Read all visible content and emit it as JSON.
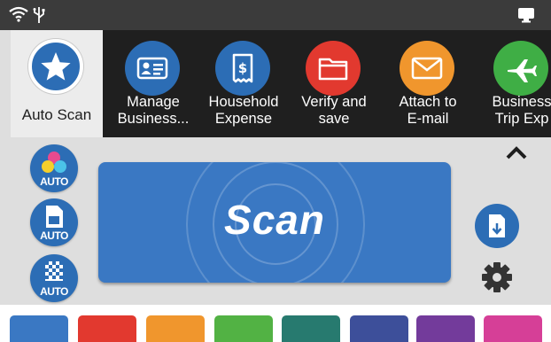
{
  "status_bar": {
    "wifi_icon": "wifi-icon",
    "usb_icon": "usb-icon",
    "screen_icon": "screen-icon"
  },
  "auto_scan": {
    "label": "Auto Scan",
    "icon": "star-icon",
    "color": "#2c6db5"
  },
  "profiles": [
    {
      "label": "Manage\nBusiness...",
      "color": "#2c6db5",
      "icon": "business-card-icon"
    },
    {
      "label": "Household\nExpense",
      "color": "#2c6db5",
      "icon": "receipt-icon"
    },
    {
      "label": "Verify and\nsave",
      "color": "#e2392f",
      "icon": "folder-icon"
    },
    {
      "label": "Attach to\nE-mail",
      "color": "#f0962d",
      "icon": "envelope-icon"
    },
    {
      "label": "Business\nTrip Exp",
      "color": "#3fae45",
      "icon": "airplane-icon"
    }
  ],
  "left_buttons": [
    {
      "label": "AUTO",
      "icon": "color-mode-auto-icon"
    },
    {
      "label": "AUTO",
      "icon": "paper-size-auto-icon"
    },
    {
      "label": "AUTO",
      "icon": "resolution-auto-icon"
    }
  ],
  "scan_button": {
    "label": "Scan",
    "color": "#3a78c3"
  },
  "right_controls": {
    "collapse_icon": "chevron-up-icon",
    "feed_icon": "document-feed-icon",
    "settings_icon": "gear-icon"
  },
  "color_swatches": [
    "#3a78c3",
    "#e2392f",
    "#f0962d",
    "#52b244",
    "#277a6f",
    "#3d4f9a",
    "#733b9b",
    "#d63f97"
  ]
}
